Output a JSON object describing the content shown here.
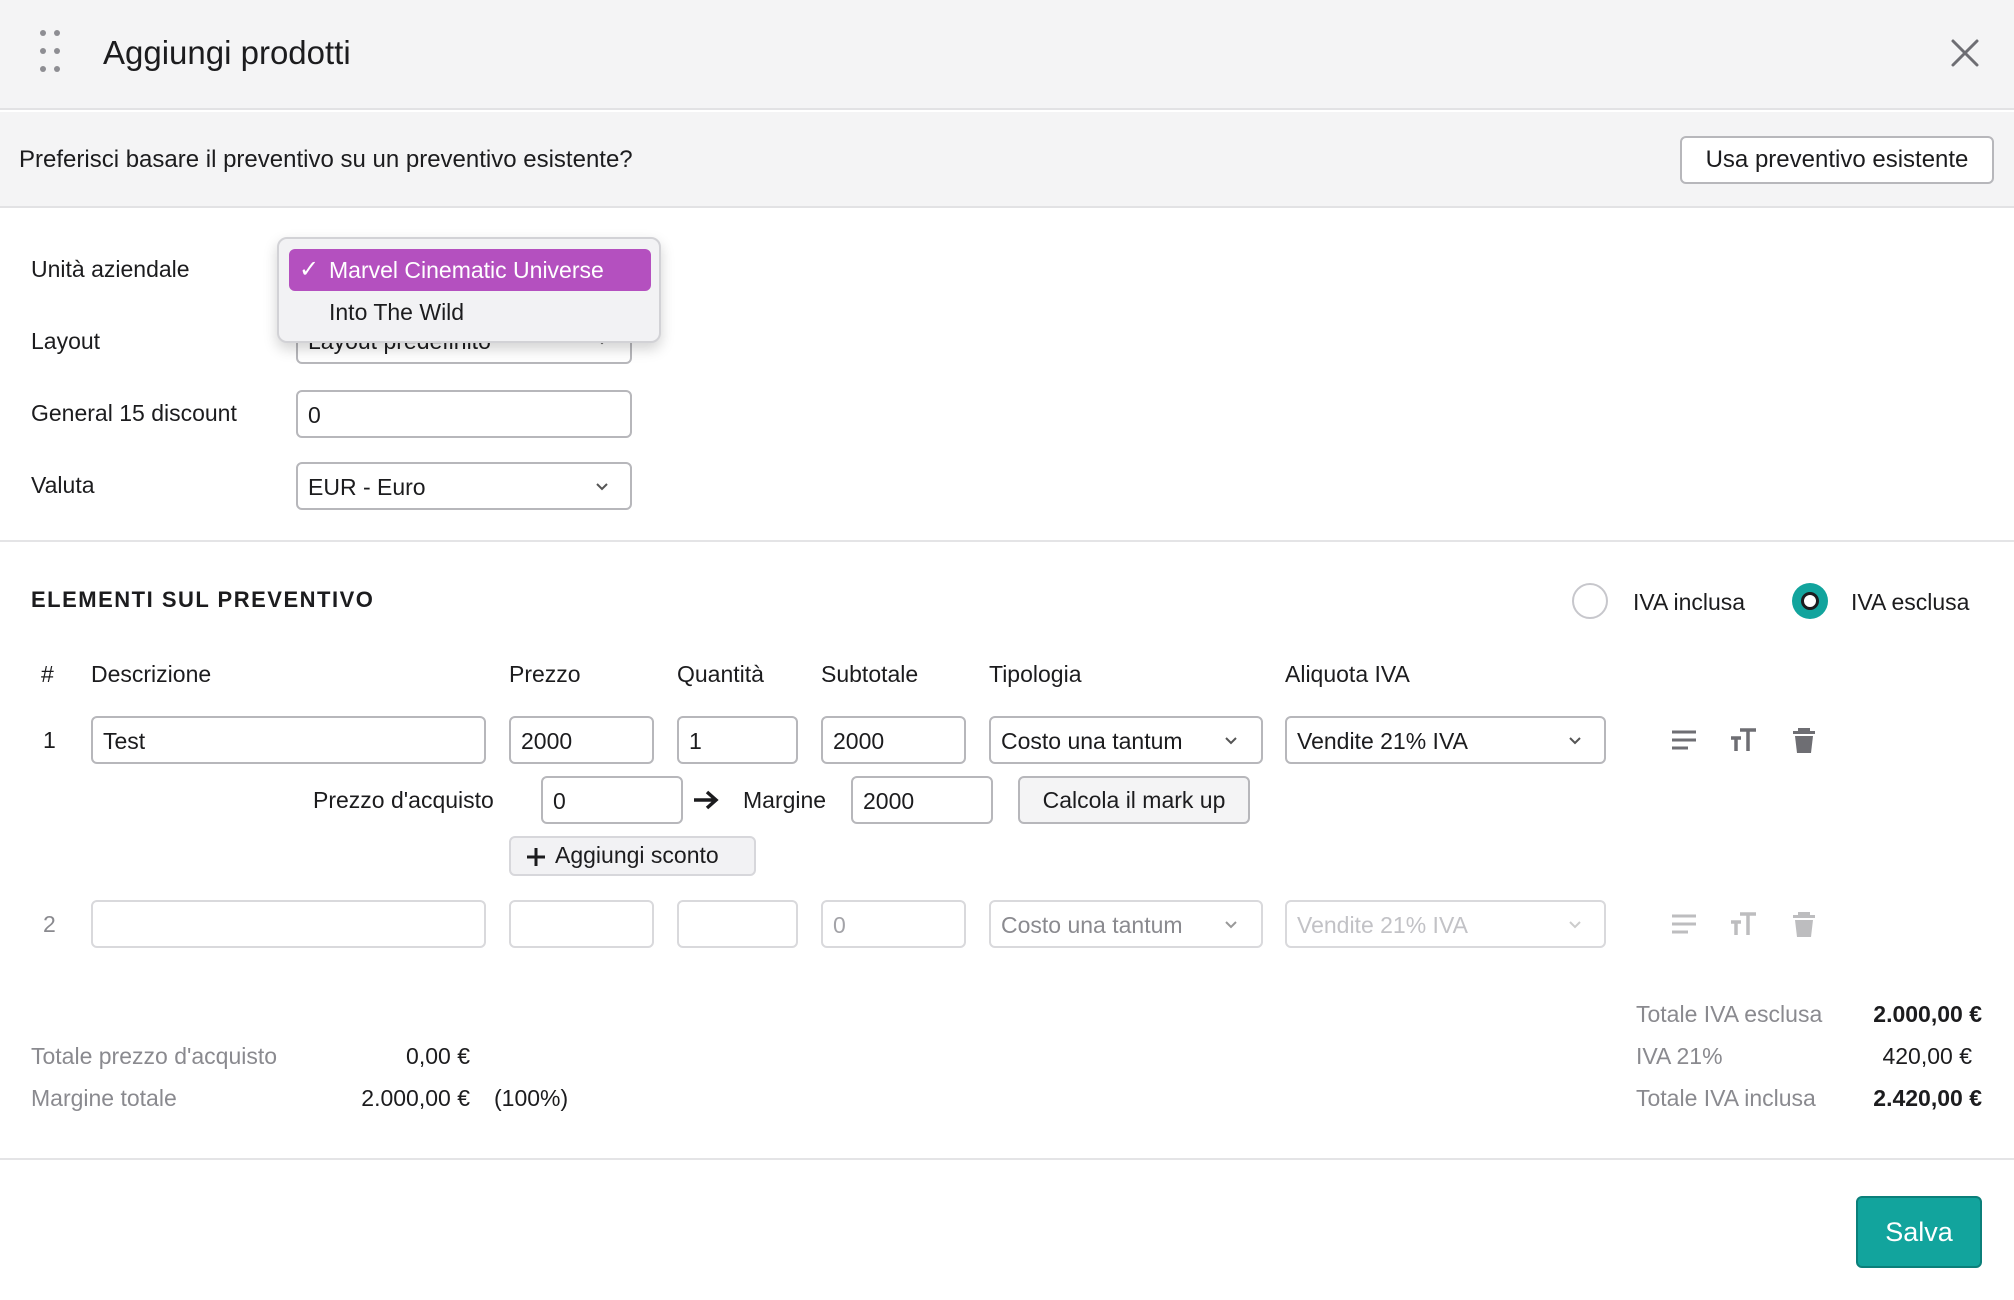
{
  "dialog": {
    "title": "Aggiungi prodotti"
  },
  "banner": {
    "question": "Preferisci basare il preventivo su un preventivo esistente?",
    "button": "Usa preventivo esistente"
  },
  "form": {
    "business_unit_label": "Unità aziendale",
    "business_unit_options": [
      "Marvel Cinematic Universe",
      "Into The Wild"
    ],
    "business_unit_selected": "Marvel Cinematic Universe",
    "layout_label": "Layout",
    "layout_value": "Layout predefinito",
    "discount_label": "General 15 discount",
    "discount_value": "0",
    "currency_label": "Valuta",
    "currency_value": "EUR - Euro"
  },
  "items": {
    "section_title": "ELEMENTI SUL PREVENTIVO",
    "vat_included_label": "IVA inclusa",
    "vat_excluded_label": "IVA esclusa",
    "vat_mode_selected": "IVA esclusa",
    "headers": {
      "num": "#",
      "description": "Descrizione",
      "price": "Prezzo",
      "quantity": "Quantità",
      "subtotal": "Subtotale",
      "type": "Tipologia",
      "vat_rate": "Aliquota IVA"
    },
    "rows": [
      {
        "num": "1",
        "description": "Test",
        "price": "2000",
        "quantity": "1",
        "subtotal": "2000",
        "type": "Costo una tantum",
        "vat": "Vendite 21% IVA"
      },
      {
        "num": "2",
        "description": "",
        "price": "",
        "quantity": "",
        "subtotal": "0",
        "type": "Costo una tantum",
        "vat": "Vendite 21% IVA"
      }
    ],
    "purchase_price_label": "Prezzo d'acquisto",
    "purchase_price_value": "0",
    "margin_label": "Margine",
    "margin_value": "2000",
    "markup_button": "Calcola il mark up",
    "add_discount_button": "Aggiungi sconto"
  },
  "totals": {
    "total_purchase_label": "Totale prezzo d'acquisto",
    "total_purchase_value": "0,00 €",
    "total_margin_label": "Margine totale",
    "total_margin_value": "2.000,00 €",
    "total_margin_pct": "(100%)",
    "total_excl_label": "Totale IVA esclusa",
    "total_excl_value": "2.000,00 €",
    "vat_label": "IVA 21%",
    "vat_value": "420,00 €",
    "total_incl_label": "Totale IVA inclusa",
    "total_incl_value": "2.420,00 €"
  },
  "footer": {
    "save_button": "Salva"
  },
  "colors": {
    "accent": "#12a49d",
    "selected_option": "#b450bf",
    "header_bg": "#f4f4f5",
    "muted_text": "#8a8a8f"
  },
  "icons": [
    "drag-handle-icon",
    "close-icon",
    "chevron-down-icon",
    "checkmark-icon",
    "arrow-right-icon",
    "plus-icon",
    "description-lines-icon",
    "text-size-icon",
    "trash-icon"
  ]
}
